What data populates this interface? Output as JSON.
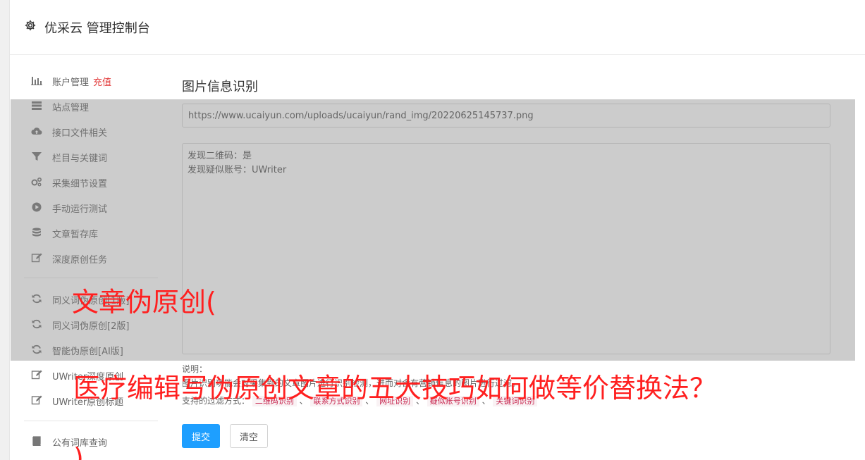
{
  "header": {
    "title": "优采云 管理控制台",
    "icon": "gear-icon"
  },
  "sidebar": {
    "items": [
      {
        "label": "账户管理",
        "extra": "充值",
        "icon": "bar-chart-icon"
      },
      {
        "label": "站点管理",
        "icon": "server-icon"
      },
      {
        "label": "接口文件相关",
        "icon": "cloud-upload-icon"
      },
      {
        "label": "栏目与关键词",
        "icon": "filter-icon"
      },
      {
        "label": "采集细节设置",
        "icon": "gears-icon"
      },
      {
        "label": "手动运行测试",
        "icon": "play-circle-icon"
      },
      {
        "label": "文章暂存库",
        "icon": "database-icon"
      },
      {
        "label": "深度原创任务",
        "icon": "edit-icon"
      },
      {
        "label": "同义词伪原创[1版]",
        "icon": "refresh-icon"
      },
      {
        "label": "同义词伪原创[2版]",
        "icon": "refresh-icon"
      },
      {
        "label": "智能伪原创[AI版]",
        "icon": "refresh-icon"
      },
      {
        "label": "UWriter深度原创",
        "icon": "edit-icon"
      },
      {
        "label": "UWriter原创标题",
        "icon": "edit-icon"
      },
      {
        "label": "公有词库查询",
        "icon": "book-icon"
      }
    ]
  },
  "main": {
    "title": "图片信息识别",
    "url_value": "https://www.ucaiyun.com/uploads/ucaiyun/rand_img/20220625145737.png",
    "result_lines": [
      "发现二维码：是",
      "发现疑似账号：UWriter"
    ],
    "desc_label": "说明：",
    "desc_text": "图片识别功能会对采集到的文章图片进行识别检测，进而对含有营销信息的图片进行过滤。",
    "filters_label": "支持的过滤方式：",
    "filters": [
      "二维码识别",
      "联系方式识别",
      "网址识别",
      "疑似账号识别",
      "关键词识别"
    ],
    "submit_label": "提交",
    "clear_label": "清空"
  },
  "watermark": {
    "line1": "文章伪原创(",
    "line2": "医疗编辑写伪原创文章的五大技巧如何做等价替换法？",
    "line3": ")",
    "color": "#ff1f1f"
  }
}
